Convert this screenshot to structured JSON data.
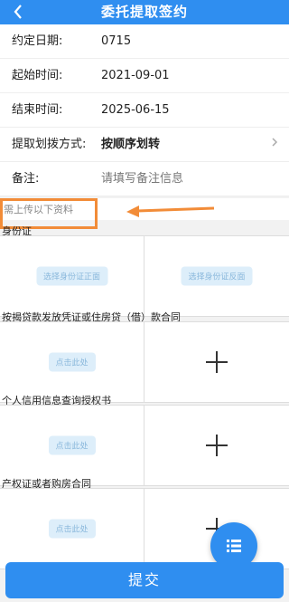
{
  "header": {
    "back_icon": "chevron-left-icon",
    "title": "委托提取签约"
  },
  "form": {
    "rows": [
      {
        "label": "约定日期:",
        "value": "0715"
      },
      {
        "label": "起始时间:",
        "value": "2021-09-01"
      },
      {
        "label": "结束时间:",
        "value": "2025-06-15"
      },
      {
        "label": "提取划拨方式:",
        "value": "按顺序划转"
      },
      {
        "label": "备注:",
        "placeholder": "请填写备注信息"
      }
    ]
  },
  "notice": "需上传以下资料",
  "sections": [
    {
      "title": "身份证",
      "left_label": "选择身份证正面",
      "right_label": "选择身份证反面"
    },
    {
      "title": "按揭贷款发放凭证或住房贷（借）款合同",
      "left_label": "点击此处"
    },
    {
      "title": "个人信用信息查询授权书",
      "left_label": "点击此处"
    },
    {
      "title": "产权证或者购房合同",
      "left_label": "点击此处"
    }
  ],
  "submit_label": "提交",
  "colors": {
    "primary": "#2f8ef0",
    "highlight": "#f28c38"
  }
}
